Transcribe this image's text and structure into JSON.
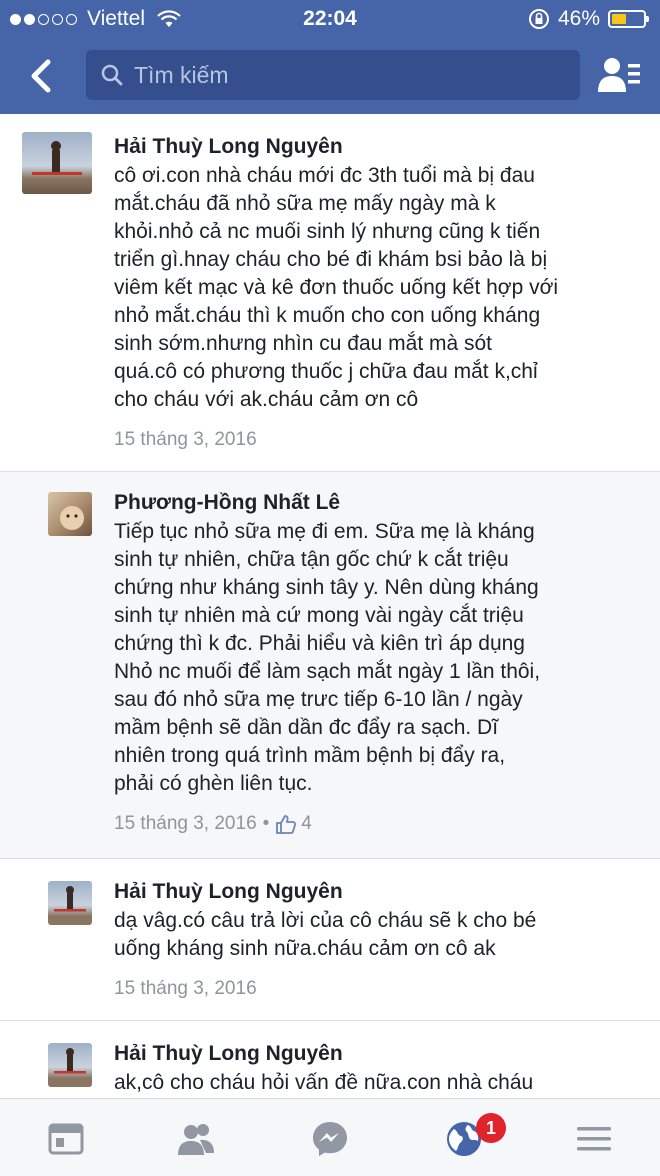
{
  "status_bar": {
    "carrier": "Viettel",
    "time": "22:04",
    "battery": "46%",
    "battery_level": 0.46
  },
  "nav": {
    "search_placeholder": "Tìm kiếm",
    "icons": [
      "back-chevron-icon",
      "search-icon",
      "friend-list-icon"
    ]
  },
  "comments": [
    {
      "author": "Hải Thuỳ Long Nguyên",
      "lines": [
        "cô ơi.con nhà cháu mới đc 3th tuổi mà bị đau",
        "mắt.cháu đã nhỏ sữa mẹ mấy ngày mà k",
        "khỏi.nhỏ cả nc muối sinh lý nhưng cũng k tiến",
        "triển gì.hnay cháu cho bé đi khám bsi bảo là bị",
        "viêm kết mạc và kê đơn thuốc uống kết hợp với",
        "nhỏ mắt.cháu thì k muốn cho con uống kháng",
        "sinh sớm.nhưng nhìn cu đau mắt mà sót",
        "quá.cô có phương thuốc j chữa đau mắt k,chỉ",
        "cho cháu với ak.cháu cảm ơn cô"
      ],
      "date": "15 tháng 3, 2016"
    },
    {
      "author": "Phương-Hồng Nhất Lê",
      "lines": [
        "Tiếp tục nhỏ sữa mẹ đi em. Sữa mẹ là kháng",
        "sinh tự nhiên, chữa tận gốc chứ k cắt triệu",
        "chứng như kháng sinh tây y.  Nên dùng kháng",
        "sinh tự nhiên mà cứ mong vài ngày cắt triệu",
        "chứng thì k đc.  Phải hiểu và kiên trì áp dụng",
        "Nhỏ nc muối để làm sạch mắt ngày 1 lần thôi,",
        "sau đó nhỏ sữa mẹ trưc tiếp 6-10 lần / ngày",
        "mầm bệnh sẽ dần dần đc đẩy ra sạch. Dĩ",
        "nhiên trong quá trình mầm bệnh bị đẩy ra,",
        "phải có ghèn liên tục."
      ],
      "date": "15 tháng 3, 2016",
      "separator": "•",
      "likes": "4"
    },
    {
      "author": "Hải Thuỳ Long Nguyên",
      "lines": [
        "dạ vâg.có câu trả lời của cô cháu sẽ k cho bé",
        "uống kháng sinh nữa.cháu cảm ơn cô ak"
      ],
      "date": "15 tháng 3, 2016"
    },
    {
      "author": "Hải Thuỳ Long Nguyên",
      "lines": [
        "ak,cô cho cháu hỏi vấn đề nữa.con nhà cháu"
      ]
    }
  ],
  "tab_bar": {
    "icons": [
      "news-feed-icon",
      "friend-requests-icon",
      "messenger-icon",
      "notifications-globe-icon",
      "menu-icon"
    ],
    "notification_badge": "1"
  },
  "colors": {
    "header_blue": "#4565a8",
    "search_field": "#354f8e",
    "badge_red": "#e0242b",
    "timestamp_gray": "#90949c"
  }
}
